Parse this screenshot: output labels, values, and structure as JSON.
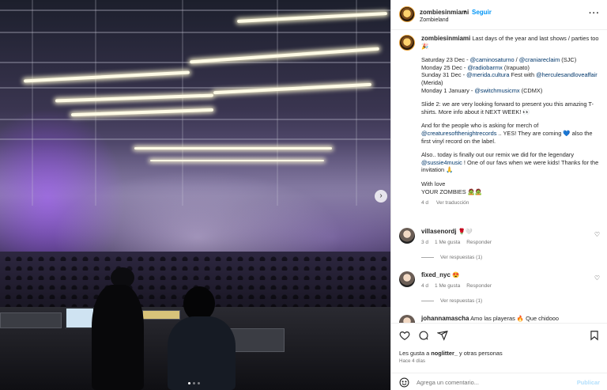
{
  "post": {
    "username": "zombiesinmiami",
    "follow_label": "Seguir",
    "location": "Zombieland",
    "more": "···"
  },
  "caption": {
    "username": "zombiesinmiami",
    "line1": "Last days of the year and last shows / parties too 🎉",
    "shows": [
      {
        "prefix": "Saturday 23 Dec - ",
        "m1": "@caminosaturno",
        "mid": " / ",
        "m2": "@craniareclaim",
        "suffix": " (SJC)"
      },
      {
        "prefix": "Monday 25 Dec - ",
        "m1": "@radiobarmx",
        "mid": "",
        "m2": "",
        "suffix": " (Irapuato)"
      },
      {
        "prefix": "Sunday 31 Dec - ",
        "m1": "@merida.cultura",
        "mid": " Fest with ",
        "m2": "@herculesandloveaffair",
        "suffix": " (Merida)"
      },
      {
        "prefix": "Monday 1 January - ",
        "m1": "@switchmusicmx",
        "mid": "",
        "m2": "",
        "suffix": " (CDMX)"
      }
    ],
    "slide2": "Slide 2: we are very looking forward to present you this amazing T-shirts. More info about it NEXT WEEK! 👀",
    "merch_pre": "And for the people who is asking for merch of ",
    "merch_mention": "@creaturesofthenightrecords",
    "merch_post": " .. YES! They are coming 💙 also the first vinyl record on the label.",
    "remix_pre": "Also.. today is finally out our remix we did for the legendary ",
    "remix_mention": "@sussie4music",
    "remix_post": " ! One of our favs when we were kids! Thanks for the invitation 🙏",
    "signoff1": "With love",
    "signoff2": "YOUR ZOMBIES 🧟🧟",
    "age": "4 d",
    "translate": "Ver traducción"
  },
  "comments": [
    {
      "username": "villasenordj",
      "text": "🌹🤍",
      "age": "3 d",
      "likes": "1 Me gusta",
      "reply": "Responder",
      "replies": "Ver respuestas (1)"
    },
    {
      "username": "fixed_nyc",
      "text": "😍",
      "age": "4 d",
      "likes": "1 Me gusta",
      "reply": "Responder",
      "replies": "Ver respuestas (1)"
    },
    {
      "username": "johannamascha",
      "text": "Amo las playeras 🔥 Que chidooo"
    }
  ],
  "likes": {
    "prefix": "Les gusta a ",
    "user": "noglitter_",
    "suffix": " y otras personas"
  },
  "time_ago": "Hace 4 días",
  "comment_box": {
    "placeholder": "Agrega un comentario...",
    "post": "Publicar"
  },
  "colors": {
    "link": "#00376b",
    "follow": "#0095f6",
    "muted": "#737373"
  },
  "carousel": {
    "slides": 3,
    "active": 1
  }
}
